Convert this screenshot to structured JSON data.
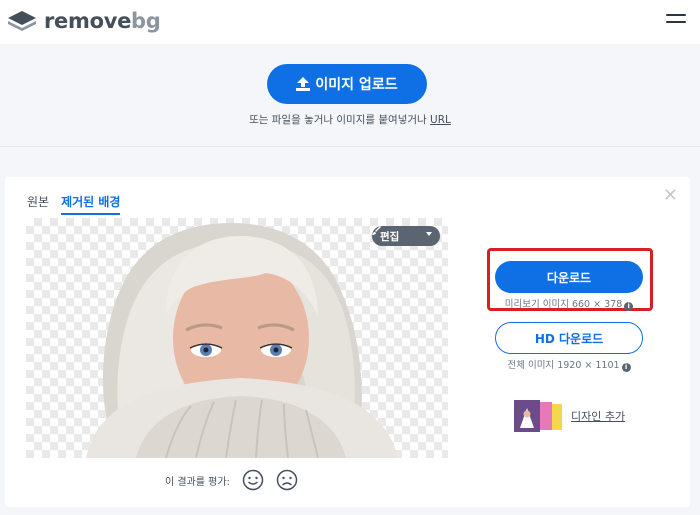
{
  "header": {
    "logo_word_main": "remove",
    "logo_word_accent": "bg",
    "menu_icon": "hamburger-icon"
  },
  "upload": {
    "button_label": "이미지 업로드",
    "button_icon": "upload-icon",
    "hint_text": "또는 파일을 놓거나 이미지를 붙여넣거나 ",
    "hint_url": "URL"
  },
  "result": {
    "tabs": [
      {
        "label": "원본",
        "active": false
      },
      {
        "label": "제거된 배경",
        "active": true
      }
    ],
    "close_icon": "close-icon",
    "edit_button_label": "편집",
    "rating_label": "이 결과를 평가:",
    "rating_icons": [
      "smile-icon",
      "frown-icon"
    ]
  },
  "download": {
    "button_label": "다운로드",
    "preview_info": "미리보기 이미지 660 × 378",
    "hd_button_label": "HD 다운로드",
    "hd_info": "전체 이미지 1920 × 1101",
    "design_label": "디자인 추가"
  },
  "colors": {
    "accent": "#0f70e6",
    "highlight": "#d61f26",
    "text": "#454f5b",
    "page_bg": "#f4f6f9"
  }
}
